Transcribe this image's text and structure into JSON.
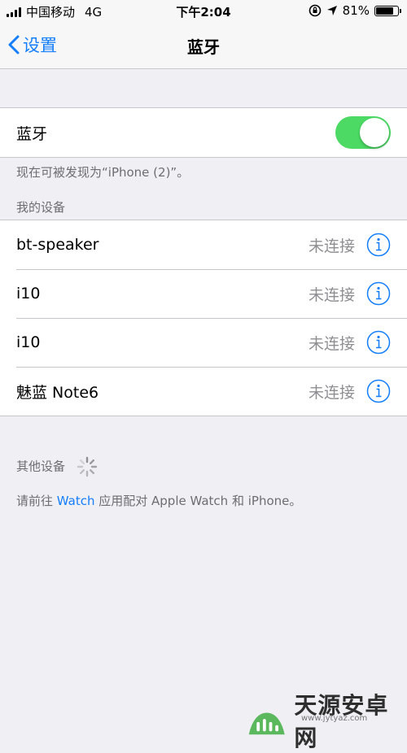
{
  "status_bar": {
    "carrier": "中国移动",
    "network": "4G",
    "time": "下午2:04",
    "battery_percent": "81%",
    "battery_level": 0.81
  },
  "nav": {
    "back_label": "设置",
    "title": "蓝牙"
  },
  "bluetooth": {
    "label": "蓝牙",
    "enabled": true,
    "discoverable_note": "现在可被发现为“iPhone (2)”。"
  },
  "my_devices": {
    "header": "我的设备",
    "items": [
      {
        "name": "bt-speaker",
        "status": "未连接"
      },
      {
        "name": "i10",
        "status": "未连接"
      },
      {
        "name": "i10",
        "status": "未连接"
      },
      {
        "name": "魅蓝 Note6",
        "status": "未连接"
      }
    ]
  },
  "other_devices": {
    "header": "其他设备"
  },
  "pairing_note": {
    "prefix": "请前往 ",
    "link": "Watch",
    "suffix": " 应用配对 Apple Watch 和 iPhone。"
  },
  "watermark": {
    "text": "天源安卓网",
    "url": "www.jytyaz.com"
  },
  "colors": {
    "accent": "#147efb",
    "toggle_on": "#4cd964",
    "background": "#efeff4"
  }
}
